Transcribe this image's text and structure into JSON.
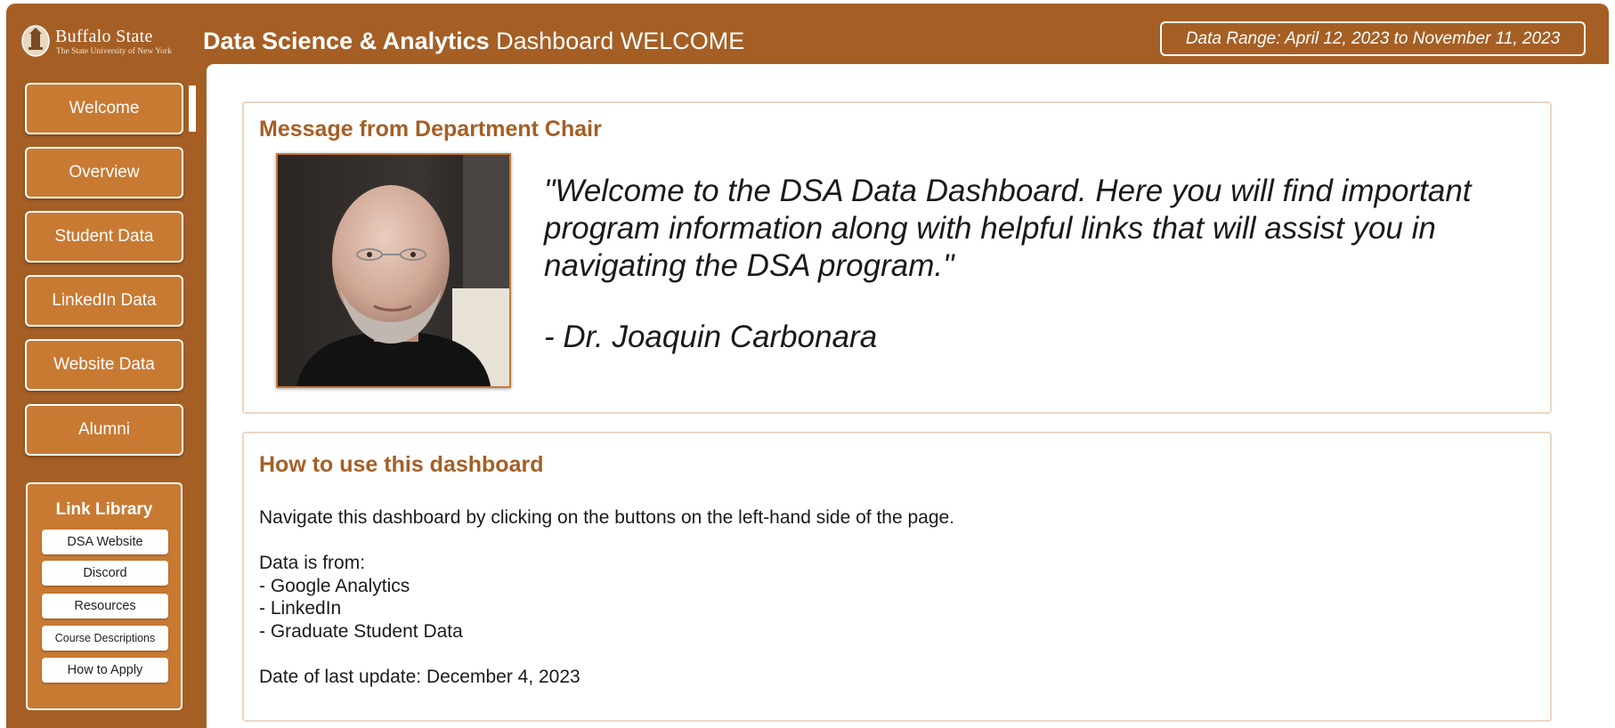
{
  "header": {
    "logo_name": "Buffalo State",
    "logo_subtitle": "The State University of New York",
    "title_bold": "Data Science & Analytics",
    "title_rest": " Dashboard WELCOME",
    "date_range": "Data Range: April 12, 2023 to November 11, 2023"
  },
  "nav": {
    "items": [
      {
        "label": "Welcome"
      },
      {
        "label": "Overview"
      },
      {
        "label": "Student Data"
      },
      {
        "label": "LinkedIn Data"
      },
      {
        "label": "Website Data"
      },
      {
        "label": "Alumni"
      }
    ],
    "active": "Welcome"
  },
  "link_library": {
    "title": "Link Library",
    "links": [
      {
        "label": "DSA Website"
      },
      {
        "label": "Discord"
      },
      {
        "label": "Resources"
      },
      {
        "label": "Course Descriptions"
      },
      {
        "label": "How to Apply"
      }
    ]
  },
  "chair_message": {
    "title": "Message from Department Chair",
    "quote": "\"Welcome to the DSA Data Dashboard. Here you will find important program information along with helpful links that will assist you in navigating the DSA program.\"",
    "author": "- Dr. Joaquin Carbonara"
  },
  "howto": {
    "title": "How to use this dashboard",
    "instructions": "Navigate this dashboard by clicking on the buttons on the left-hand side of the page.",
    "sources_heading": "Data is from:",
    "sources": [
      "- Google Analytics",
      "- LinkedIn",
      "- Graduate Student Data"
    ],
    "last_update": "Date of last update: December 4, 2023"
  },
  "colors": {
    "brand": "#a55f25",
    "button": "#c87a33",
    "card_border": "#ead7c4"
  }
}
